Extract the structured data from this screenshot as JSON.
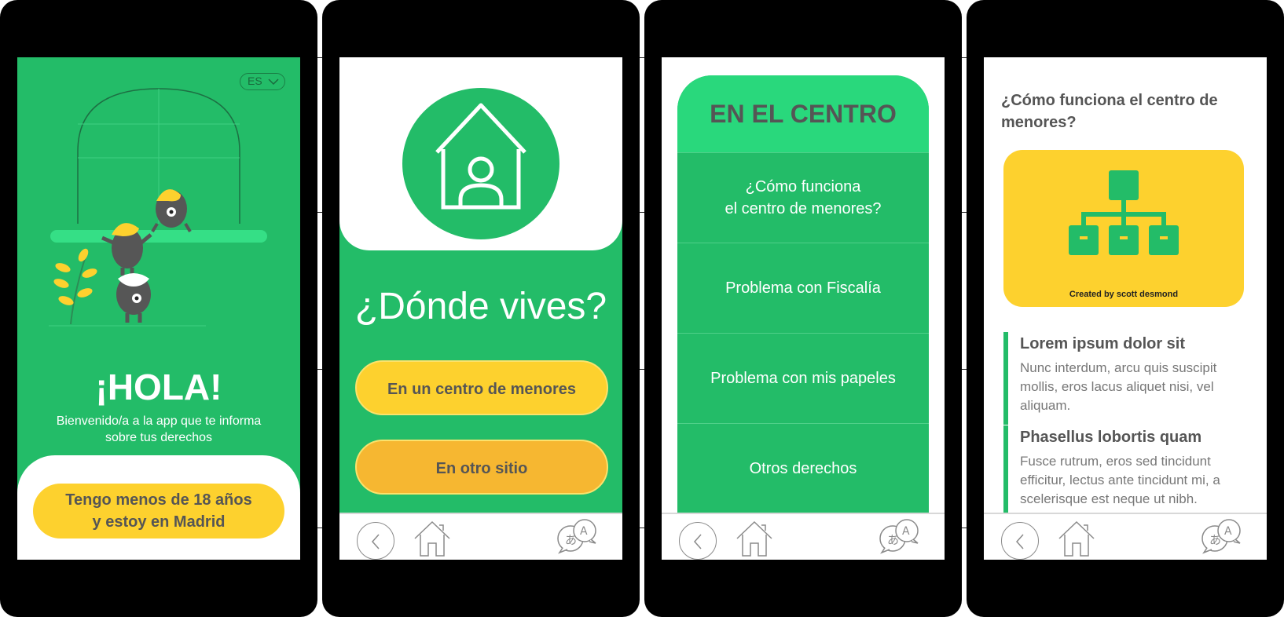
{
  "colors": {
    "green": "#23bc68",
    "green_light": "#29d87c",
    "yellow": "#fdd12e",
    "orange": "#f6b731",
    "text_gray": "#555555"
  },
  "screen1": {
    "language": "ES",
    "greeting": "¡HOLA!",
    "welcome_line1": "Bienvenido/a a la app que te informa",
    "welcome_line2": "sobre tus derechos",
    "age_button_line1": "Tengo menos de 18 años",
    "age_button_line2": "y estoy en Madrid"
  },
  "screen2": {
    "icon": "house-person-icon",
    "question": "¿Dónde vives?",
    "option1": "En un centro de menores",
    "option2": "En otro sitio"
  },
  "screen3": {
    "header": "EN EL CENTRO",
    "items": [
      {
        "line1": "¿Cómo funciona",
        "line2": "el centro de menores?"
      },
      {
        "line1": "Problema con Fiscalía"
      },
      {
        "line1": "Problema con mis papeles"
      },
      {
        "line1": "Otros derechos"
      }
    ]
  },
  "screen4": {
    "title": "¿Cómo funciona el centro de menores?",
    "image_credit": "Created by scott desmond",
    "image_icon": "org-chart-icon",
    "sections": [
      {
        "title": "Lorem ipsum dolor sit",
        "body": "Nunc interdum, arcu quis suscipit mollis, eros lacus aliquet nisi, vel aliquam."
      },
      {
        "title": "Phasellus lobortis quam",
        "body": "Fusce rutrum, eros sed tincidunt efficitur, lectus ante tincidunt mi, a scelerisque est neque ut nibh."
      }
    ]
  },
  "nav": {
    "icons": [
      "back-icon",
      "home-icon",
      "translate-icon"
    ]
  }
}
